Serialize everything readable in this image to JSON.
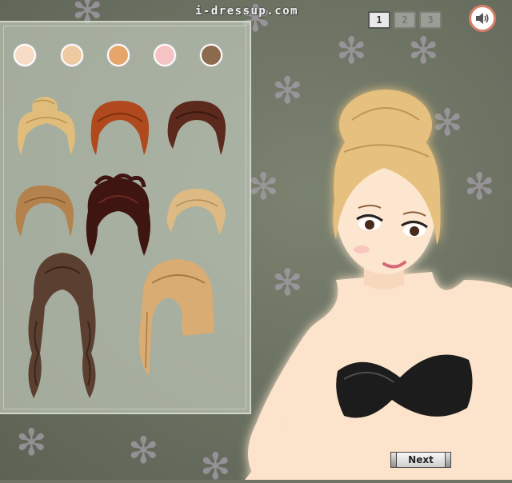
{
  "site": {
    "brand": "i-dressup.com"
  },
  "pager": {
    "pages": [
      "1",
      "2",
      "3"
    ],
    "active_page": "1"
  },
  "sound": {
    "icon": "speaker-icon",
    "state": "on"
  },
  "skin_swatches": [
    {
      "name": "swatch-pale",
      "color": "#f7ddc6"
    },
    {
      "name": "swatch-light",
      "color": "#eec9a1"
    },
    {
      "name": "swatch-tan",
      "color": "#e6a56a"
    },
    {
      "name": "swatch-pink",
      "color": "#f6c3c4"
    },
    {
      "name": "swatch-brown",
      "color": "#8c6a4e"
    }
  ],
  "hair_options": [
    {
      "name": "hair-blonde-updo-bun",
      "color": "#e1bd7c"
    },
    {
      "name": "hair-red-short",
      "color": "#b0491d"
    },
    {
      "name": "hair-dark-bob",
      "color": "#5c2a1c"
    },
    {
      "name": "hair-light-brown-short",
      "color": "#b4824c"
    },
    {
      "name": "hair-messy-burgundy-updo",
      "color": "#3e1511"
    },
    {
      "name": "hair-blonde-swept",
      "color": "#ddb984"
    },
    {
      "name": "hair-long-wavy-brown",
      "color": "#5b4032"
    },
    {
      "name": "hair-blonde-long-bangs",
      "color": "#d9ac73"
    }
  ],
  "buttons": {
    "next_label": "Next"
  }
}
